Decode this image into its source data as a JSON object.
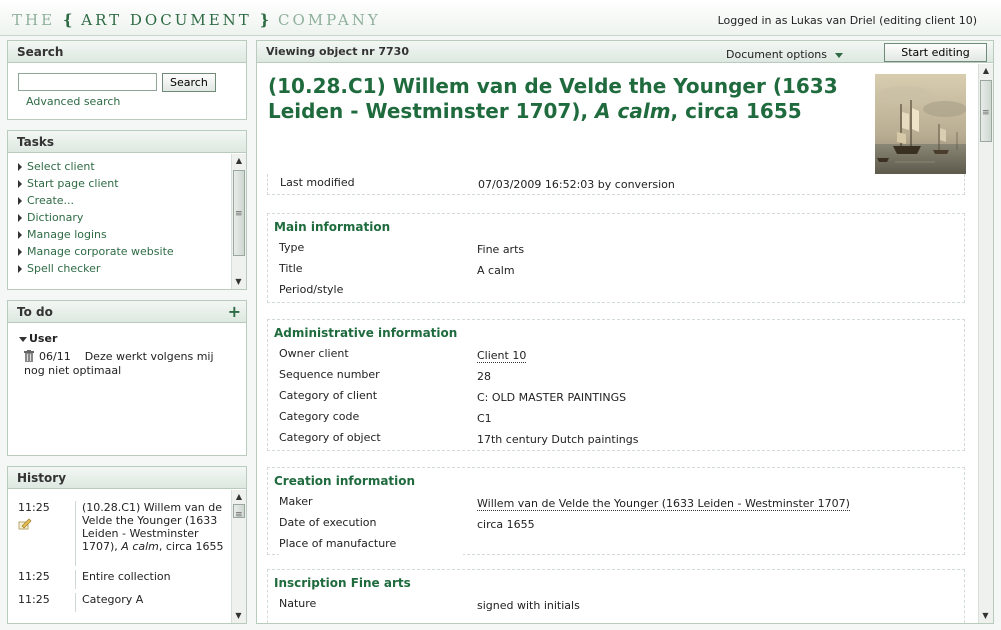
{
  "header": {
    "logo_left": "THE",
    "logo_brace_open": "{",
    "logo_middle": "ART DOCUMENT",
    "logo_brace_close": "}",
    "logo_right": "COMPANY",
    "user_info": "Logged in as Lukas van Driel (editing client 10)"
  },
  "search": {
    "title": "Search",
    "input_value": "",
    "button_label": "Search",
    "advanced_label": "Advanced search"
  },
  "tasks": {
    "title": "Tasks",
    "items": [
      "Select client",
      "Start page client",
      "Create...",
      "Dictionary",
      "Manage logins",
      "Manage corporate website",
      "Spell checker"
    ]
  },
  "todo": {
    "title": "To do",
    "group_label": "User",
    "item_date": "06/11",
    "item_text": "Deze werkt volgens mij nog niet optimaal"
  },
  "history": {
    "title": "History",
    "rows": [
      {
        "time": "11:25",
        "desc_plain": "(10.28.C1) Willem van de Velde the Younger (1633 Leiden - Westminster 1707),",
        "desc_italic": "A calm",
        "desc_tail": ", circa 1655"
      },
      {
        "time": "11:25",
        "desc_plain": "Entire collection"
      },
      {
        "time": "11:25",
        "desc_plain": "Category A"
      }
    ]
  },
  "viewer": {
    "viewing_label": "Viewing object nr 7730",
    "document_options_label": "Document options",
    "start_editing_label": "Start editing",
    "title_plain": "(10.28.C1) Willem van de Velde the Younger (1633 Leiden - Westminster 1707),",
    "title_italic": "A calm",
    "title_tail": ", circa 1655",
    "last_modified_label": "Last modified",
    "last_modified_value": "07/03/2009 16:52:03 by conversion"
  },
  "sections": {
    "main": {
      "title": "Main information",
      "fields": [
        {
          "label": "Type",
          "value": "Fine arts"
        },
        {
          "label": "Title",
          "value": "A calm"
        },
        {
          "label": "Period/style",
          "value": ""
        }
      ]
    },
    "admin": {
      "title": "Administrative information",
      "fields": [
        {
          "label": "Owner client",
          "value": "Client 10"
        },
        {
          "label": "Sequence number",
          "value": "28"
        },
        {
          "label": "Category of client",
          "value": "C: OLD MASTER PAINTINGS"
        },
        {
          "label": "Category code",
          "value": "C1"
        },
        {
          "label": "Category of object",
          "value": "17th century Dutch paintings"
        }
      ]
    },
    "creation": {
      "title": "Creation information",
      "fields": [
        {
          "label": "Maker",
          "value": "Willem van de Velde the Younger (1633 Leiden - Westminster 1707)"
        },
        {
          "label": "Date of execution",
          "value": "circa 1655"
        },
        {
          "label": "Place of manufacture",
          "value": ""
        }
      ]
    },
    "inscription": {
      "title": "Inscription Fine arts",
      "fields": [
        {
          "label": "Nature",
          "value": "signed with initials"
        }
      ]
    }
  },
  "colors": {
    "accent_green": "#1f6b3e",
    "link_green": "#2e6b44",
    "logo_light": "#8fb09b"
  }
}
